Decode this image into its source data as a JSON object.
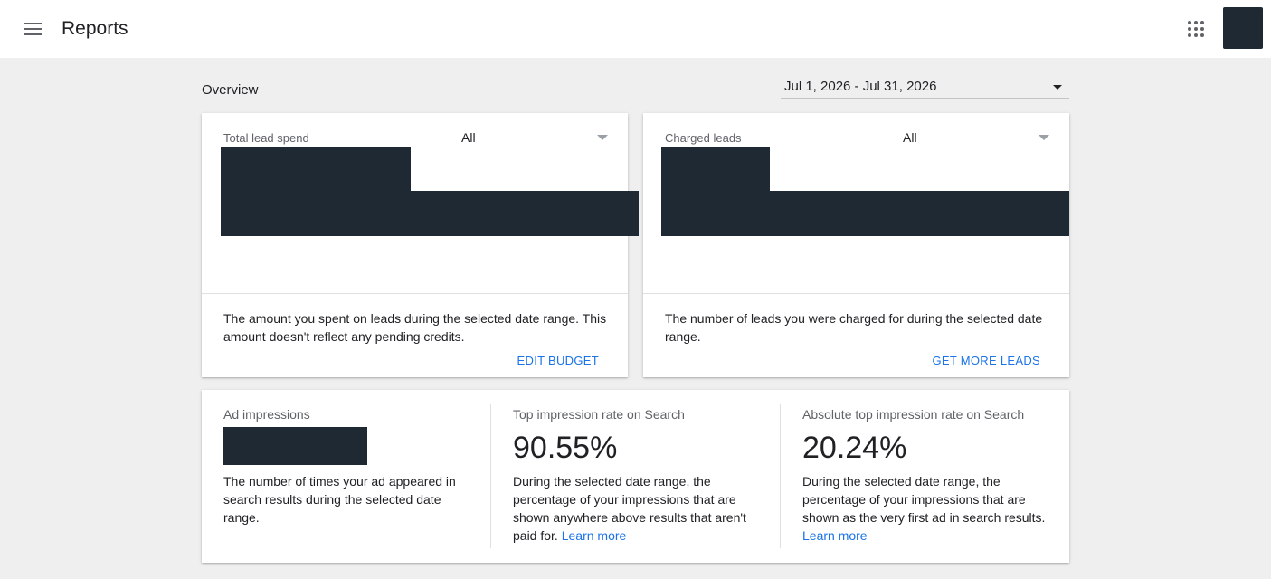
{
  "topbar": {
    "menu_icon": "menu-icon",
    "title": "Reports",
    "apps_icon": "apps-grid-icon"
  },
  "overview": {
    "title": "Overview",
    "date_range": "Jul 1, 2026 - Jul 31, 2026"
  },
  "cards": {
    "lead_spend": {
      "label": "Total lead spend",
      "filter": "All",
      "description": "The amount you spent on leads during the selected date range. This amount doesn't reflect any pending credits.",
      "action": "EDIT BUDGET"
    },
    "charged_leads": {
      "label": "Charged leads",
      "filter": "All",
      "description": "The number of leads you were charged for during the selected date range.",
      "action": "GET MORE LEADS"
    }
  },
  "metrics": {
    "ad_impressions": {
      "label": "Ad impressions",
      "description": "The number of times your ad appeared in search results during the selected date range."
    },
    "top_impression_rate": {
      "label": "Top impression rate on Search",
      "value": "90.55%",
      "description": "During the selected date range, the percentage of your impressions that are shown anywhere above results that aren't paid for.",
      "link": "Learn more"
    },
    "absolute_top_impression_rate": {
      "label": "Absolute top impression rate on Search",
      "value": "20.24%",
      "description": "During the selected date range, the percentage of your impressions that are shown as the very first ad in search results.",
      "link": "Learn more"
    }
  },
  "colors": {
    "accent": "#1a73e8",
    "redaction": "#1f2933",
    "background": "#efefef"
  }
}
